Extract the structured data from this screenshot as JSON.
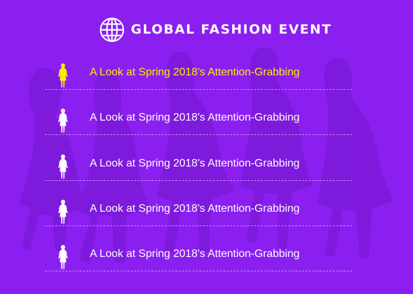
{
  "header": {
    "title": "GLOBAL FASHION EVENT",
    "icon": "globe-icon"
  },
  "items": [
    {
      "label": "A Look at Spring 2018's Attention-Grabbing",
      "icon": "female-figure-icon",
      "active": true
    },
    {
      "label": "A Look at Spring 2018's Attention-Grabbing",
      "icon": "female-figure-icon",
      "active": false
    },
    {
      "label": "A Look at Spring 2018's Attention-Grabbing",
      "icon": "female-figure-icon",
      "active": false
    },
    {
      "label": "A Look at Spring 2018's Attention-Grabbing",
      "icon": "female-figure-icon",
      "active": false
    },
    {
      "label": "A Look at Spring 2018's Attention-Grabbing",
      "icon": "female-figure-icon",
      "active": false
    }
  ],
  "colors": {
    "background": "#8b1ff0",
    "accent": "#f7ef00",
    "text": "#ffffff"
  }
}
